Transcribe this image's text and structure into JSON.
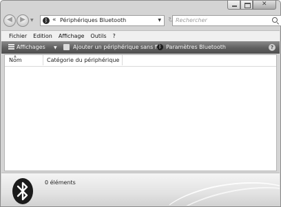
{
  "window": {
    "caption_buttons": [
      "minimize",
      "maximize",
      "close"
    ]
  },
  "address_bar": {
    "path_prefix": "«",
    "location": "Périphériques Bluetooth",
    "icon": "bluetooth-icon"
  },
  "search": {
    "placeholder": "Rechercher"
  },
  "menu": {
    "items": [
      "Fichier",
      "Edition",
      "Affichage",
      "Outils",
      "?"
    ]
  },
  "toolbar": {
    "views_label": "Affichages",
    "add_label": "Ajouter un périphérique sans fil",
    "settings_label": "Paramètres Bluetooth",
    "help_label": "?"
  },
  "columns": {
    "name": "Nom",
    "category": "Catégorie du périphérique"
  },
  "details": {
    "count_text": "0 éléments",
    "icon": "bluetooth-icon"
  }
}
